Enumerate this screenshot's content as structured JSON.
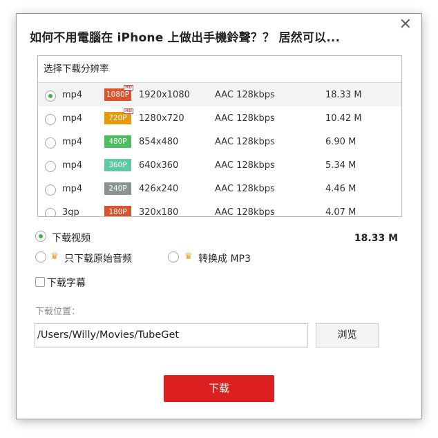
{
  "dialog": {
    "title": "如何不用電腦在 iPhone 上做出手機鈴聲？？ 居然可以...",
    "close_glyph": "✕"
  },
  "resolution": {
    "header": "选择下载分辨率",
    "rows": [
      {
        "format": "mp4",
        "badge": "1080P",
        "badge_color": "#d9532c",
        "hd": true,
        "hd_label": "HD",
        "dimensions": "1920x1080",
        "audio": "AAC 128kbps",
        "size": "18.33 M",
        "selected": true
      },
      {
        "format": "mp4",
        "badge": "720P",
        "badge_color": "#e39a0c",
        "hd": true,
        "hd_label": "HD",
        "dimensions": "1280x720",
        "audio": "AAC 128kbps",
        "size": "10.42 M",
        "selected": false
      },
      {
        "format": "mp4",
        "badge": "480P",
        "badge_color": "#4dbb5f",
        "hd": false,
        "dimensions": "854x480",
        "audio": "AAC 128kbps",
        "size": "6.90 M",
        "selected": false
      },
      {
        "format": "mp4",
        "badge": "360P",
        "badge_color": "#5ccba5",
        "hd": false,
        "dimensions": "640x360",
        "audio": "AAC 128kbps",
        "size": "5.34 M",
        "selected": false
      },
      {
        "format": "mp4",
        "badge": "240P",
        "badge_color": "#8a948e",
        "hd": false,
        "dimensions": "426x240",
        "audio": "AAC 128kbps",
        "size": "4.46 M",
        "selected": false
      },
      {
        "format": "3gp",
        "badge": "180P",
        "badge_color": "#d9532c",
        "hd": false,
        "dimensions": "320x180",
        "audio": "AAC 128kbps",
        "size": "4.07 M",
        "selected": false
      }
    ]
  },
  "options": {
    "download_video": "下载视频",
    "original_audio": "只下载原始音频",
    "convert_mp3": "转换成 MP3",
    "crown_icon": "crown-icon",
    "total_size": "18.33 M",
    "subtitles": "下载字幕"
  },
  "location": {
    "label": "下载位置：",
    "path": "/Users/Willy/Movies/TubeGet",
    "browse": "浏览"
  },
  "download_button": "下载"
}
